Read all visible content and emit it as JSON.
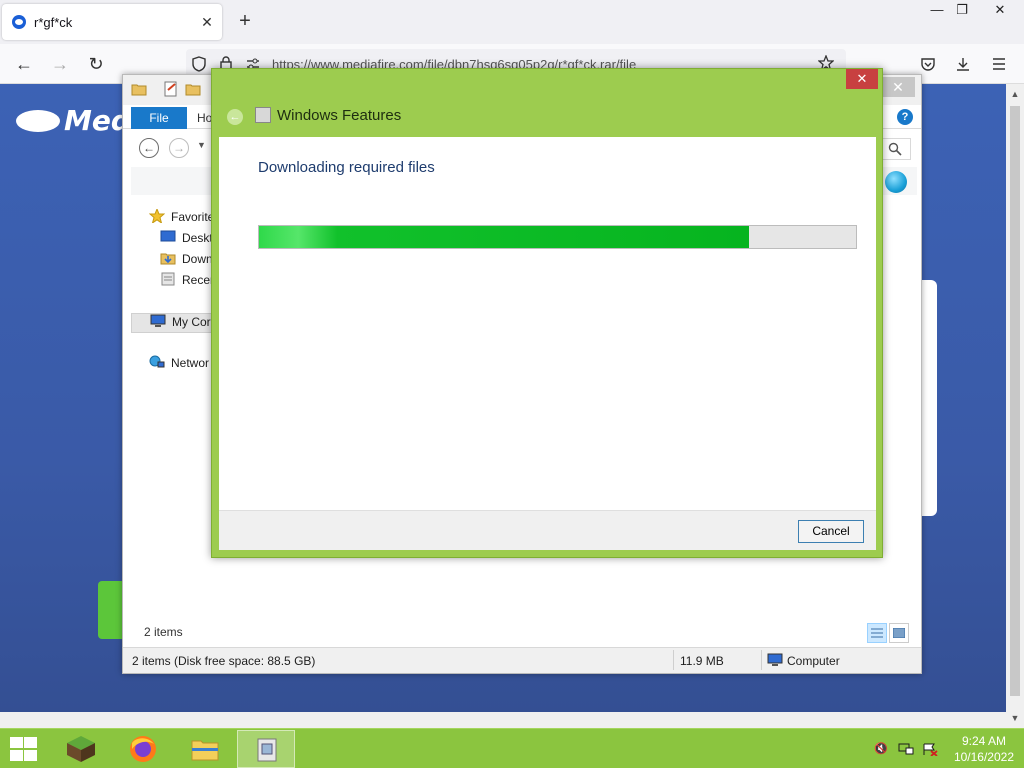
{
  "browser": {
    "tab_title": "r*gf*ck",
    "tab_close": "✕",
    "new_tab": "+",
    "url": "https://www.mediafire.com/file/dbn7hsq6sq05p2q/r*gf*ck.rar/file",
    "window_controls": {
      "minimize": "—",
      "restore": "❐",
      "close": "✕"
    },
    "nav": {
      "back": "←",
      "forward": "→",
      "reload": "↻"
    }
  },
  "webpage": {
    "logo_text": "Medi"
  },
  "explorer": {
    "ribbon": {
      "file_tab": "File",
      "home_tab": "Ho"
    },
    "help": "?",
    "sidebar": [
      {
        "label": "Favorite",
        "icon": "star-icon"
      },
      {
        "label": "Deskt",
        "icon": "desktop-icon"
      },
      {
        "label": "Down",
        "icon": "downloads-icon"
      },
      {
        "label": "Recer",
        "icon": "recent-places-icon"
      },
      {
        "label": "My Cor",
        "icon": "computer-icon"
      },
      {
        "label": "Networ",
        "icon": "network-icon"
      }
    ],
    "item_count": "2 items",
    "statusbar": {
      "summary": "2 items (Disk free space: 88.5 GB)",
      "size": "11.9 MB",
      "location": "Computer"
    }
  },
  "dialog": {
    "title": "Windows Features",
    "heading": "Downloading required files",
    "progress_fraction": 0.82,
    "cancel_label": "Cancel",
    "close_glyph": "✕",
    "back_glyph": "←"
  },
  "taskbar": {
    "apps": [
      "minecraft-icon",
      "firefox-icon",
      "file-explorer-icon",
      "windows-features-icon"
    ],
    "time": "9:24 AM",
    "date": "10/16/2022"
  },
  "colors": {
    "dialog_frame": "#9dcc4f",
    "taskbar": "#8bc53f",
    "progress": "#06b41f",
    "explorer_accent": "#1979ca"
  }
}
